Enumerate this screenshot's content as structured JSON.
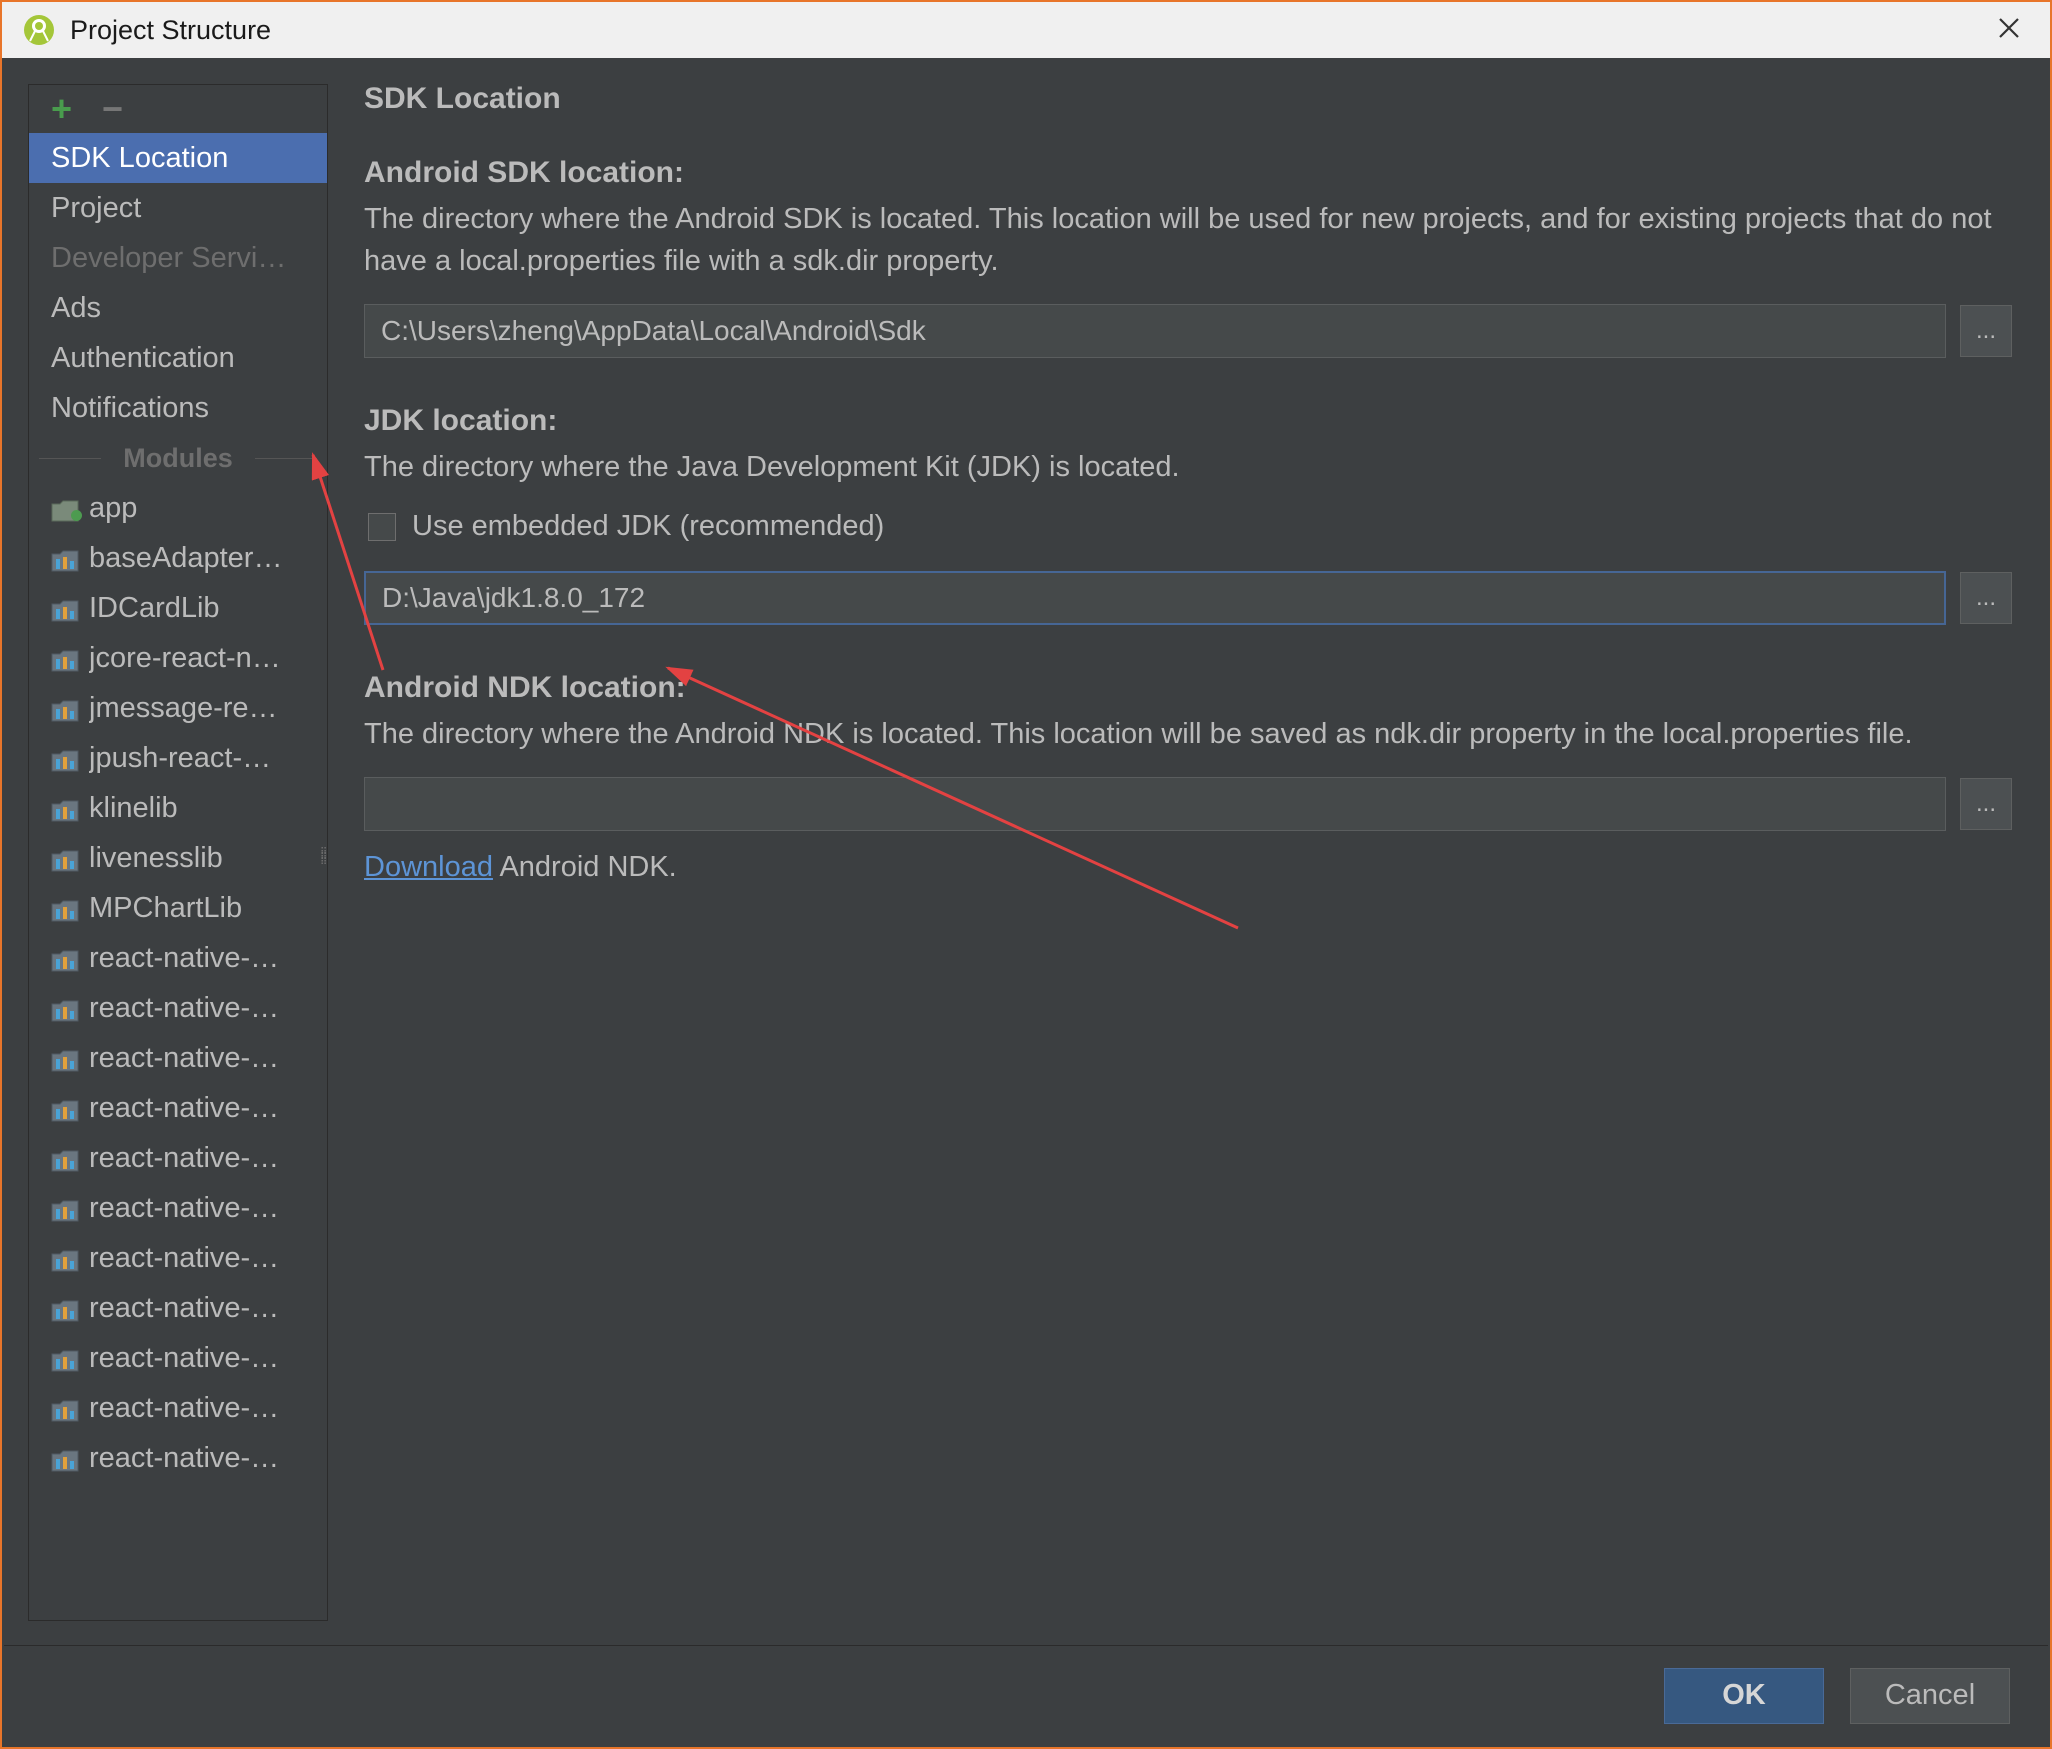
{
  "window": {
    "title": "Project Structure"
  },
  "sidebar": {
    "items": [
      {
        "label": "SDK Location",
        "selected": true
      },
      {
        "label": "Project"
      },
      {
        "label": "Developer Servi…",
        "disabled": true
      },
      {
        "label": "Ads"
      },
      {
        "label": "Authentication"
      },
      {
        "label": "Notifications"
      }
    ],
    "modules_header": "Modules",
    "modules": [
      {
        "label": "app",
        "app": true
      },
      {
        "label": "baseAdapter…"
      },
      {
        "label": "IDCardLib"
      },
      {
        "label": "jcore-react-n…"
      },
      {
        "label": "jmessage-re…"
      },
      {
        "label": "jpush-react-…"
      },
      {
        "label": "klinelib"
      },
      {
        "label": "livenesslib"
      },
      {
        "label": "MPChartLib"
      },
      {
        "label": "react-native-…"
      },
      {
        "label": "react-native-…"
      },
      {
        "label": "react-native-…"
      },
      {
        "label": "react-native-…"
      },
      {
        "label": "react-native-…"
      },
      {
        "label": "react-native-…"
      },
      {
        "label": "react-native-…"
      },
      {
        "label": "react-native-…"
      },
      {
        "label": "react-native-…"
      },
      {
        "label": "react-native-…"
      },
      {
        "label": "react-native-…"
      }
    ]
  },
  "content": {
    "heading": "SDK Location",
    "sdk": {
      "label": "Android SDK location:",
      "desc": "The directory where the Android SDK is located. This location will be used for new projects, and for existing projects that do not have a local.properties file with a sdk.dir property.",
      "value": "C:\\Users\\zheng\\AppData\\Local\\Android\\Sdk"
    },
    "jdk": {
      "label": "JDK location:",
      "desc": "The directory where the Java Development Kit (JDK) is located.",
      "checkbox_label": "Use embedded JDK (recommended)",
      "value": "D:\\Java\\jdk1.8.0_172"
    },
    "ndk": {
      "label": "Android NDK location:",
      "desc": "The directory where the Android NDK is located. This location will be saved as ndk.dir property in the local.properties file.",
      "value": "",
      "download_link": "Download",
      "download_rest": " Android NDK."
    }
  },
  "footer": {
    "ok": "OK",
    "cancel": "Cancel"
  },
  "browse_label": "..."
}
